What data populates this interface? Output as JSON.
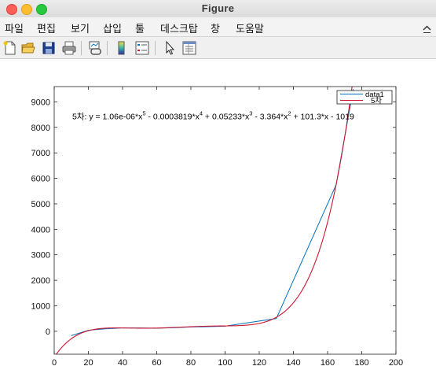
{
  "window": {
    "title": "Figure"
  },
  "menu": [
    {
      "id": "file",
      "label": "파일"
    },
    {
      "id": "edit",
      "label": "편집"
    },
    {
      "id": "view",
      "label": "보기"
    },
    {
      "id": "insert",
      "label": "삽입"
    },
    {
      "id": "tools",
      "label": "툴"
    },
    {
      "id": "desktop",
      "label": "데스크탑"
    },
    {
      "id": "window",
      "label": "창"
    },
    {
      "id": "help",
      "label": "도움말"
    }
  ],
  "toolbar": {
    "buttons": [
      {
        "id": "new-figure",
        "icon": "new-figure-icon"
      },
      {
        "id": "open-file",
        "icon": "open-folder-icon"
      },
      {
        "id": "save",
        "icon": "save-icon"
      },
      {
        "id": "print",
        "icon": "print-icon"
      },
      {
        "id": "link-plot",
        "icon": "link-plot-icon"
      },
      {
        "id": "insert-colorbar",
        "icon": "colorbar-icon"
      },
      {
        "id": "insert-legend",
        "icon": "legend-icon"
      },
      {
        "id": "edit-plot",
        "icon": "pointer-icon"
      },
      {
        "id": "property-inspector",
        "icon": "property-inspector-icon"
      }
    ]
  },
  "chart_data": {
    "type": "line",
    "xlim": [
      0,
      200
    ],
    "ylim": [
      -900,
      9600
    ],
    "x_ticks": [
      0,
      20,
      40,
      60,
      80,
      100,
      120,
      140,
      160,
      180,
      200
    ],
    "y_ticks": [
      0,
      1000,
      2000,
      3000,
      4000,
      5000,
      6000,
      7000,
      8000,
      9000
    ],
    "grid": false,
    "legend": {
      "placement": "top-right",
      "entries": [
        "data1",
        "5차"
      ]
    },
    "annotation": {
      "prefix": "5차:  y = 1.06e-06*x",
      "sup1": "5",
      "part2": " - 0.0003819*x",
      "sup2": "4",
      "part3": " + 0.05233*x",
      "sup3": "3",
      "part4": " - 3.364*x",
      "sup4": "2",
      "part5": " + 101.3*x - 1019"
    },
    "series": [
      {
        "name": "data1",
        "color": "#0072bd",
        "x": [
          10,
          20,
          30,
          40,
          50,
          60,
          70,
          80,
          90,
          100,
          110,
          120,
          130,
          165,
          175
        ],
        "y": [
          -170,
          40,
          95,
          130,
          130,
          120,
          140,
          170,
          180,
          200,
          300,
          400,
          500,
          5750,
          9500
        ]
      },
      {
        "name": "5차",
        "color": "#d01530",
        "fit_coefficients": [
          1.06e-06,
          -0.0003819,
          0.05233,
          -3.364,
          101.3,
          -1019
        ],
        "x_range": [
          0,
          175
        ]
      }
    ]
  }
}
